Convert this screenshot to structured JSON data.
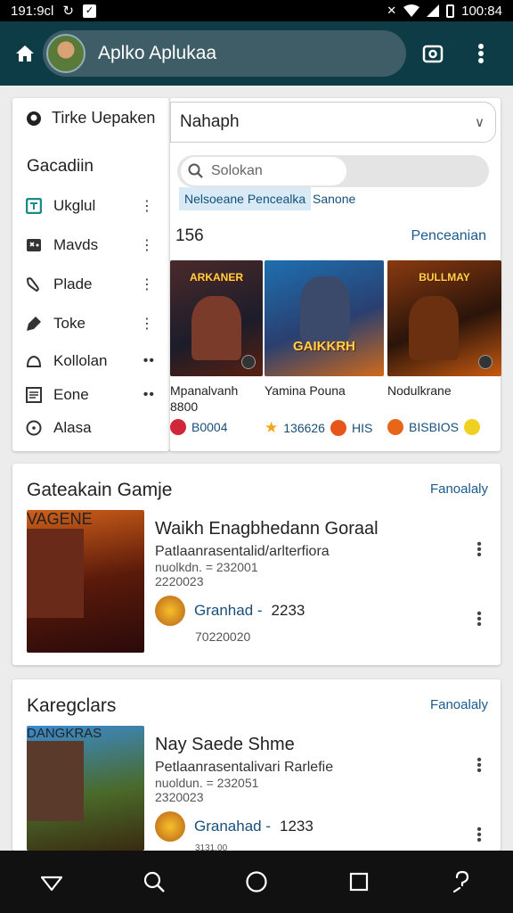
{
  "status_bar": {
    "time": "191:9cl",
    "right_time": "100:84"
  },
  "app_bar": {
    "title": "Aplko Aplukaa"
  },
  "sidebar": {
    "header": "Tirke Uepaken",
    "section": "Gacadiin",
    "items": [
      {
        "label": "Ukglul",
        "icon": "list-icon"
      },
      {
        "label": "Mavds",
        "icon": "gamepad-icon"
      },
      {
        "label": "Plade",
        "icon": "puzzle-icon"
      },
      {
        "label": "Toke",
        "icon": "tag-icon"
      },
      {
        "label": "Kollolan",
        "icon": "cloud-icon"
      },
      {
        "label": "Eone",
        "icon": "doc-icon"
      },
      {
        "label": "Alasa",
        "icon": "info-icon"
      }
    ]
  },
  "main": {
    "dropdown_value": "Nahaph",
    "search_placeholder": "Solokan",
    "tabs": [
      "Nelsoeane Pencealka",
      "Sanone"
    ],
    "count": "156",
    "see_all": "Penceanian",
    "games": [
      {
        "title": "ARKANER",
        "name": "Mpanalvanh",
        "sub": "8800",
        "stat": "B0004",
        "stat_color": "#d0283a"
      },
      {
        "title": "GAIKKRH",
        "name": "Yamina Pouna",
        "sub": "",
        "stat": "136626",
        "stat2": "HIS",
        "stat_color": "#f3a51f"
      },
      {
        "title": "BULLMAY",
        "name": "Nodulkrane",
        "sub": "",
        "stat": "BISBIOS",
        "stat_color": "#e8661a"
      }
    ]
  },
  "sections": [
    {
      "title": "Gateakain Gamje",
      "link": "Fanoalaly",
      "item": {
        "img_label": "VAGENE",
        "name": "Waikh Enagbhedann Goraal",
        "desc": "Patlaanrasentalid/arlterfiora",
        "meta1": "nuolkdn. = 232001",
        "meta2": "2220023",
        "row_label": "Granhad -",
        "row_value": "2233",
        "sub": "70220020"
      }
    },
    {
      "title": "Karegclars",
      "link": "Fanoalaly",
      "item": {
        "img_label": "DANGKRAS",
        "name": "Nay Saede Shme",
        "desc": "Petlaanrasentalivari Rarlefie",
        "meta1": "nuoldun. = 232051",
        "meta2": "2320023",
        "row_label": "Granahad -",
        "row_value": "1233",
        "sub": "3131.00"
      }
    }
  ],
  "colors": {
    "app_bar": "#0d3c46",
    "link": "#1a5a8c",
    "nav_bar": "#111111"
  }
}
